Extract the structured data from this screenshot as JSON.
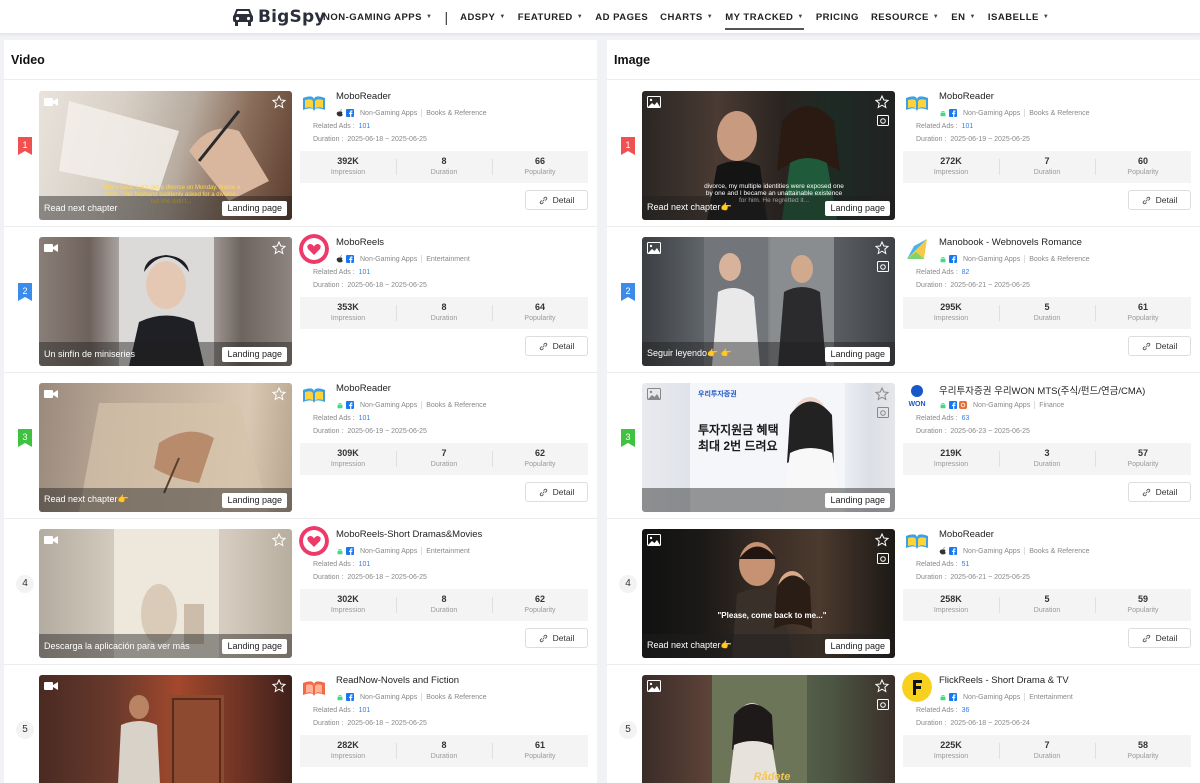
{
  "brand": {
    "name": "BigSpy"
  },
  "nav": {
    "non_gaming": "NON-GAMING APPS",
    "separator": "|",
    "adspy": "ADSPY",
    "featured": "FEATURED",
    "ad_pages": "AD PAGES",
    "charts": "CHARTS",
    "my_tracked": "MY TRACKED",
    "pricing": "PRICING",
    "resource": "RESOURCE",
    "lang": "EN",
    "user": "ISABELLE"
  },
  "labels": {
    "related_ads": "Related Ads :",
    "duration": "Duration :",
    "impression": "Impression",
    "duration_stat": "Duration",
    "popularity": "Popularity",
    "detail": "Detail",
    "landing_page": "Landing page",
    "non_gaming": "Non-Gaming Apps"
  },
  "colors": {
    "rank1": "#f05050",
    "rank2": "#3b8bea",
    "rank3": "#3fc23f",
    "link": "#2f80ed"
  },
  "video": {
    "title": "Video",
    "rows": [
      {
        "rank": "1",
        "app": "MoboReader",
        "platform": "ios",
        "category": "Books & Reference",
        "related": "101",
        "dates": "2025-06-18 ~ 2025-06-25",
        "impression": "392K",
        "duration": "8",
        "popularity": "66",
        "caption": "Read next chapter",
        "overlay": "\"She's back. Let's get a divorce on Monday. Name a price.\" Her husband suddenly asked for a divorce, but she didn't..."
      },
      {
        "rank": "2",
        "app": "MoboReels",
        "platform": "ios",
        "category": "Entertainment",
        "related": "101",
        "dates": "2025-06-18 ~ 2025-06-25",
        "impression": "353K",
        "duration": "8",
        "popularity": "64",
        "caption": "Un sinfín de miniseries"
      },
      {
        "rank": "3",
        "app": "MoboReader",
        "platform": "android",
        "category": "Books & Reference",
        "related": "101",
        "dates": "2025-06-19 ~ 2025-06-25",
        "impression": "309K",
        "duration": "7",
        "popularity": "62",
        "caption": "Read next chapter👉"
      },
      {
        "rank": "4",
        "app": "MoboReels-Short Dramas&Movies",
        "platform": "android",
        "category": "Entertainment",
        "related": "101",
        "dates": "2025-06-18 ~ 2025-06-25",
        "impression": "302K",
        "duration": "8",
        "popularity": "62",
        "caption": "Descarga la aplicación para ver más"
      },
      {
        "rank": "5",
        "app": "ReadNow-Novels and Fiction",
        "platform": "android",
        "category": "Books & Reference",
        "related": "101",
        "dates": "2025-06-18 ~ 2025-06-25",
        "impression": "282K",
        "duration": "8",
        "popularity": "61",
        "caption": ""
      }
    ]
  },
  "image": {
    "title": "Image",
    "rows": [
      {
        "rank": "1",
        "app": "MoboReader",
        "platform": "android",
        "category": "Books & Reference",
        "related": "101",
        "dates": "2025-06-19 ~ 2025-06-25",
        "impression": "272K",
        "duration": "7",
        "popularity": "60",
        "caption": "Read next chapter👉",
        "overlay": "divorce, my multiple identities were exposed one by one and I became an unattainable existence for him. He regretted it..."
      },
      {
        "rank": "2",
        "app": "Manobook - Webnovels Romance",
        "platform": "android",
        "category": "Books & Reference",
        "related": "82",
        "dates": "2025-06-21 ~ 2025-06-25",
        "impression": "295K",
        "duration": "5",
        "popularity": "61",
        "caption": "Seguir leyendo👉 👉"
      },
      {
        "rank": "3",
        "app": "우리투자증권 우리WON MTS(주식/펀드/연금/CMA)",
        "platform": "android",
        "category": "Finance",
        "related": "63",
        "dates": "2025-06-23 ~ 2025-06-25",
        "impression": "219K",
        "duration": "3",
        "popularity": "57",
        "caption": "",
        "ad_brand": "우리투자증권",
        "ad_line1": "투자지원금 혜택",
        "ad_line2": "최대 2번 드려요"
      },
      {
        "rank": "4",
        "app": "MoboReader",
        "platform": "ios",
        "category": "Books & Reference",
        "related": "51",
        "dates": "2025-06-21 ~ 2025-06-25",
        "impression": "258K",
        "duration": "5",
        "popularity": "59",
        "caption": "Read next chapter👉",
        "overlay": "\"Please, come back to me...\""
      },
      {
        "rank": "5",
        "app": "FlickReels - Short Drama & TV",
        "platform": "android",
        "category": "Entertainment",
        "related": "36",
        "dates": "2025-06-18 ~ 2025-06-24",
        "impression": "225K",
        "duration": "7",
        "popularity": "58",
        "caption": "",
        "overlay": "Rådete"
      }
    ]
  }
}
